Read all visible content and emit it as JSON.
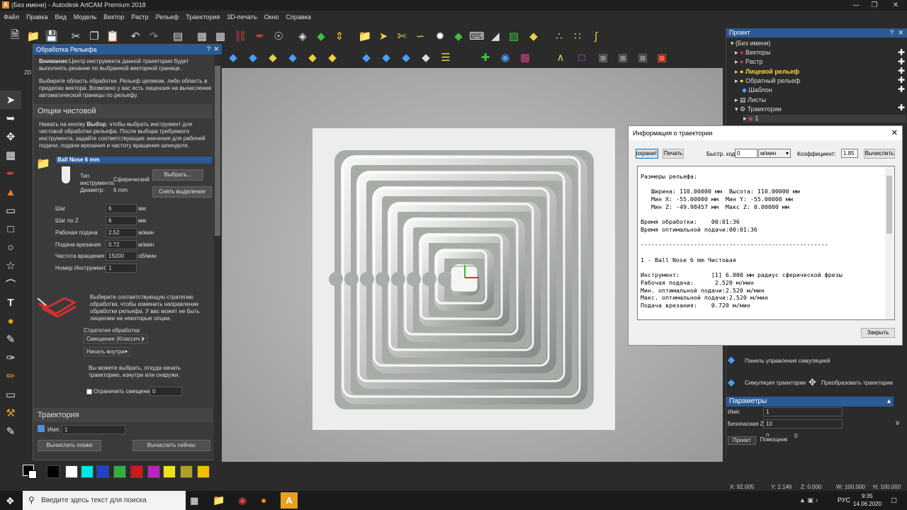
{
  "app": {
    "title": "(Без имени) - Autodesk ArtCAM Premium 2018",
    "logo": "A"
  },
  "menu": [
    "Файл",
    "Правка",
    "Вид",
    "Модель",
    "Вектор",
    "Растр",
    "Рельеф",
    "Траектория",
    "3D-печать",
    "Окно",
    "Справка"
  ],
  "relief_panel": {
    "title": "Обработка Рельефа",
    "warning_bold": "Внимание:",
    "warning_text": "Центр инструмента данной траектории будет выполнять резание по выбранной векторной границе.",
    "select_area_text": "Выберите область обработки. Рельеф целиком, либо область в пределах вектора. Возможно у вас есть лицензия на вычисление автоматической границы по рельефу.",
    "finish_section": "Опции чистовой",
    "finish_help_pre": "Нажать на кнопку ",
    "finish_help_bold": "Выбор",
    "finish_help_post": ", чтобы выбрать инструмент для чистовой обработки рельефа. После выбора требуемого инструмента, задайте соответствующие значения для рабочей подачи, подачи врезания и частоту вращения шпинделя.",
    "tool_name": "Ball Nose 6 mm",
    "tool_type_label": "Тип инструмента:",
    "tool_type_value": "Сферический",
    "diameter_label": "Диаметр:",
    "diameter_value": "6 mm",
    "select_btn": "Выбрать...",
    "deselect_btn": "Снять выделение",
    "params": [
      {
        "label": "Шаг",
        "value": "6",
        "unit": "мм"
      },
      {
        "label": "Шаг по Z",
        "value": "6",
        "unit": "мм"
      },
      {
        "label": "Рабочая подача",
        "value": "2.52",
        "unit": "м/мин"
      },
      {
        "label": "Подача врезания",
        "value": "0.72",
        "unit": "м/мин"
      },
      {
        "label": "Частота вращения",
        "value": "15000",
        "unit": "об/мин"
      },
      {
        "label": "Номер Инструмента",
        "value": "1",
        "unit": ""
      }
    ],
    "strategy_help": "Выберите соответствующую стратегию обработки, чтобы изменить направление обработки рельефа. У вас может не быть лицензии на некоторые опции.",
    "strategy_label": "Стратегия обработки:",
    "strategy_value": "Смещение (Классич.)",
    "start_value": "Начать внутри",
    "start_help": "Вы можете выбрать, откуда начать траекторию, изнутри или снаружи.",
    "limit_label": "Ограничить смещение",
    "limit_value": "0",
    "toolpath_section": "Траектория",
    "name_label": "Имя:",
    "name_value": "1",
    "calc_later": "Вычислить позже",
    "calc_now": "Вычислить сейчас"
  },
  "viewport_tab": "2D",
  "project": {
    "title": "Проект",
    "items": [
      {
        "label": "(Без имени)",
        "bold": false
      },
      {
        "label": "Векторы",
        "bold": false
      },
      {
        "label": "Растр",
        "bold": false
      },
      {
        "label": "Лицевой рельеф",
        "bold": true
      },
      {
        "label": "Обратный рельеф",
        "bold": false
      },
      {
        "label": "Шаблон",
        "bold": false
      },
      {
        "label": "Листы",
        "bold": false
      },
      {
        "label": "Траектории",
        "bold": false
      },
      {
        "label": "1",
        "bold": false
      }
    ],
    "sim_panel": "Панель управления симуляцией",
    "sim_toolpath": "Симуляция траектории",
    "transform_toolpath": "Преобразовать траектории",
    "params_header": "Параметры",
    "p_name_label": "Имя:",
    "p_name_value": "1",
    "p_safez_label": "Безопасная Z:",
    "p_safez_value": "10",
    "p_extra1": "0",
    "p_extra2": "0",
    "tab_project": "Проект",
    "tab_helper": "Помощник"
  },
  "dialog": {
    "title": "Информация о траектории",
    "save_btn": "Сохранить",
    "print_btn": "Печать",
    "rapid_label": "Быстр. ход",
    "rapid_value": "0",
    "rapid_unit": "м/мин",
    "coef_label": "Коэффициент:",
    "coef_value": "1.85",
    "calc_btn": "Вычислить",
    "close_btn": "Закрыть",
    "info_lines": [
      "Размеры рельефа:",
      "",
      "   Ширина: 110.00000 мм  Высота: 110.00000 мм",
      "   Мин X: -55.00000 мм  Мин Y: -55.00000 мм",
      "   Мин Z: -49.98457 мм  Макс Z: 0.00000 мм",
      "",
      "Время обработки:    00:01:36",
      "Время оптимальной подачи:00:01:36",
      "",
      "-----------------------------------------------------",
      "",
      "1 - Ball Nose 6 mm Чистовая",
      "",
      "Инструмент:         [1] 6.000 мм радиус сферической фрезы",
      "Рабочая подача:      2.520 м/мин",
      "Мин. оптимальной подачи:2.520 м/мин",
      "Макс. оптимальной подачи:2.520 м/мин",
      "Подача врезания:    0.720 м/мин"
    ]
  },
  "status": {
    "x": "X: 92.005",
    "y": "Y: 2.146",
    "z": "Z: 0.000",
    "w": "W: 100.000",
    "h": "H: 100.000"
  },
  "taskbar": {
    "search_placeholder": "Введите здесь текст для поиска",
    "lang": "РУС",
    "time": "9:35",
    "date": "14.06.2020"
  },
  "palette": [
    "#000000",
    "#ffffff",
    "#00e5e5",
    "#2040d0",
    "#30b040",
    "#d01818",
    "#c020c0",
    "#f0e020",
    "#b0a020",
    "#f0c000"
  ]
}
